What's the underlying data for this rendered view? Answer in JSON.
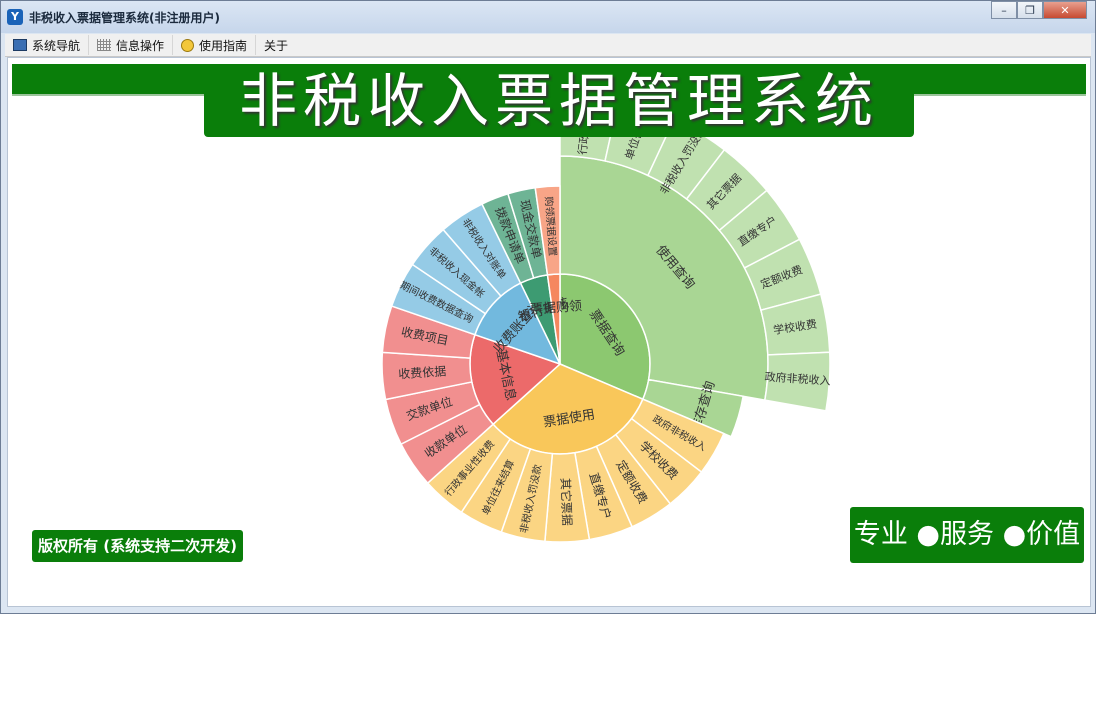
{
  "window": {
    "title": "非税收入票据管理系统(非注册用户)",
    "controls": {
      "minimize": "–",
      "restore": "❐",
      "close": "✕"
    }
  },
  "menu": [
    {
      "label": "系统导航",
      "icon": "monitor-icon"
    },
    {
      "label": "信息操作",
      "icon": "grid-icon"
    },
    {
      "label": "使用指南",
      "icon": "help-icon"
    },
    {
      "label": "关于",
      "icon": ""
    }
  ],
  "banner": {
    "title": "非税收入票据管理系统"
  },
  "footer": {
    "copyright": "版权所有 (系统支持二次开发)",
    "slogan": "专业 ●服务 ●价值"
  },
  "chart_data": {
    "type": "sunburst",
    "colors": {
      "票据查询": "#8cc870",
      "票据使用": "#f9c75a",
      "基本信息": "#ec6a6a",
      "收费账查询": "#72b9de",
      "银行审核": "#3d9b72",
      "票据购领": "#f5875f"
    },
    "inner": [
      {
        "label": "票据查询",
        "children": [
          "使用查询",
          "库存查询"
        ]
      },
      {
        "label": "票据使用",
        "children": [
          "政府非税收入",
          "学校收费",
          "定额收费",
          "直缴专户",
          "其它票据",
          "非税收入罚没款",
          "单位往来结算",
          "行政事业性收费"
        ]
      },
      {
        "label": "基本信息",
        "children": [
          "收款单位",
          "交款单位",
          "收费依据",
          "收费项目"
        ]
      },
      {
        "label": "收费账查询",
        "children": [
          "期间收费数据查询",
          "非税收入现金帐",
          "非税收入对账单"
        ]
      },
      {
        "label": "银行审核",
        "children": [
          "拨款申请单",
          "现金交款单"
        ]
      },
      {
        "label": "票据购领",
        "children": [
          "购领票据设置"
        ]
      }
    ],
    "leaves_of_使用查询": [
      "行政事业性",
      "单位往来",
      "非税收入罚没款",
      "其它票据",
      "直缴专户",
      "定额收费",
      "学校收费",
      "政府非税收入"
    ]
  }
}
